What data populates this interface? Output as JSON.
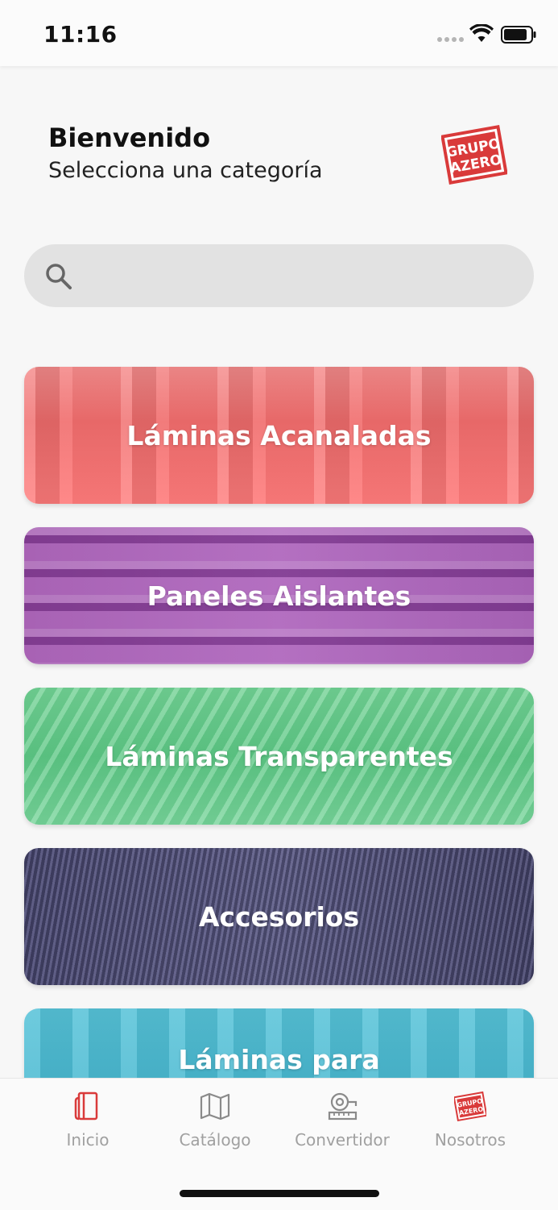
{
  "status_bar": {
    "time": "11:16"
  },
  "header": {
    "title": "Bienvenido",
    "subtitle": "Selecciona una categoría",
    "logo_text": [
      "GRUPO",
      "AZERO"
    ]
  },
  "search": {
    "placeholder": ""
  },
  "categories": [
    {
      "label": "Láminas Acanaladas"
    },
    {
      "label": "Paneles Aislantes"
    },
    {
      "label": "Láminas Transparentes"
    },
    {
      "label": "Accesorios"
    },
    {
      "label": "Láminas para"
    }
  ],
  "tabs": [
    {
      "label": "Inicio",
      "icon": "book-icon"
    },
    {
      "label": "Catálogo",
      "icon": "map-icon"
    },
    {
      "label": "Convertidor",
      "icon": "tape-measure-icon"
    },
    {
      "label": "Nosotros",
      "icon": "grupo-azero-logo-icon"
    }
  ],
  "colors": {
    "brand_red": "#d93a3a",
    "card_red": "#f07070",
    "card_purple": "#a65db3",
    "card_green": "#62ca88",
    "card_indigo": "#50507c",
    "card_cyan": "#46b8cf",
    "tab_inactive": "#a0a0a0"
  }
}
